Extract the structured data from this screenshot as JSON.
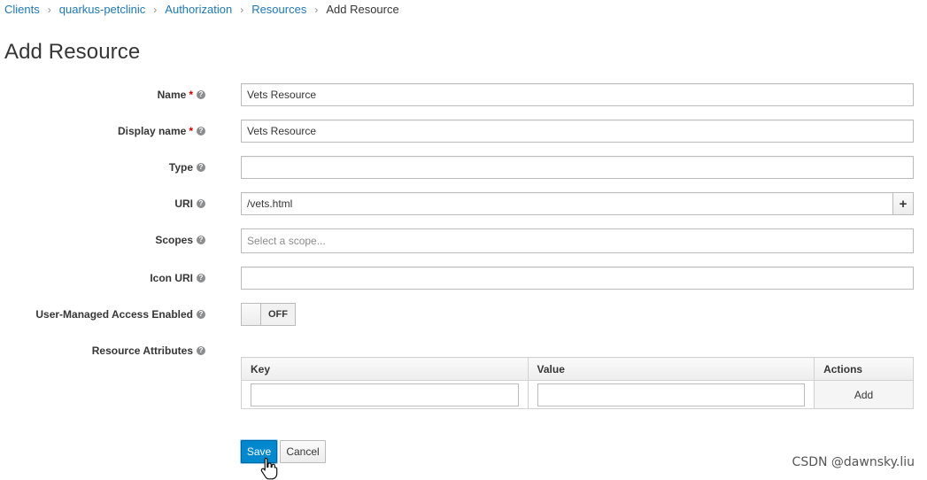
{
  "breadcrumb": {
    "items": [
      "Clients",
      "quarkus-petclinic",
      "Authorization",
      "Resources"
    ],
    "current": "Add Resource",
    "separator": "›"
  },
  "title": "Add Resource",
  "form": {
    "name": {
      "label": "Name",
      "value": "Vets Resource"
    },
    "display_name": {
      "label": "Display name",
      "value": "Vets Resource"
    },
    "type": {
      "label": "Type",
      "value": ""
    },
    "uri": {
      "label": "URI",
      "value": "/vets.html",
      "add_symbol": "+"
    },
    "scopes": {
      "label": "Scopes",
      "placeholder": "Select a scope..."
    },
    "icon_uri": {
      "label": "Icon URI",
      "value": ""
    },
    "uma": {
      "label": "User-Managed Access Enabled",
      "state": "OFF"
    },
    "attributes": {
      "label": "Resource Attributes",
      "columns": [
        "Key",
        "Value",
        "Actions"
      ],
      "add_label": "Add"
    }
  },
  "required_mark": "*",
  "help_glyph": "?",
  "buttons": {
    "save": "Save",
    "cancel": "Cancel"
  },
  "watermark": "CSDN @dawnsky.liu",
  "colors": {
    "link": "#1f78b4",
    "primary": "#0088ce",
    "required": "#cc0000"
  }
}
